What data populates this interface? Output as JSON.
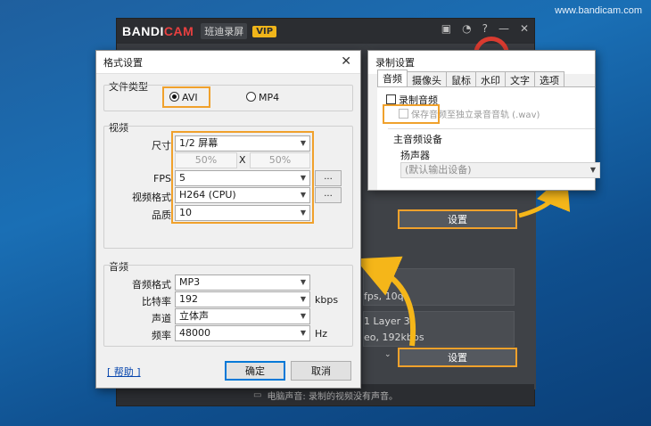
{
  "watermark": "www.bandicam.com",
  "bandicam": {
    "logo_a": "BANDI",
    "logo_b": "CAM",
    "subtitle": "班迪录屏",
    "vip": "VIP",
    "video_info": "fps, 10q",
    "audio_info_1": "1 Layer 3",
    "audio_info_2": "eo, 192kbps",
    "settings_btn_1": "设置",
    "settings_btn_2": "设置",
    "footer": "电脑声音: 录制的视频没有声音。"
  },
  "format_dialog": {
    "title": "格式设置",
    "file_type_label": "文件类型",
    "avi": "AVI",
    "mp4": "MP4",
    "video_label": "视频",
    "size_label": "尺寸",
    "size_value": "1/2 屏幕",
    "width_pct": "50%",
    "x_sep": "X",
    "height_pct": "50%",
    "fps_label": "FPS",
    "fps_value": "5",
    "more": "...",
    "vformat_label": "视频格式",
    "vformat_value": "H264 (CPU)",
    "quality_label": "品质",
    "quality_value": "10",
    "audio_label": "音频",
    "aformat_label": "音频格式",
    "aformat_value": "MP3",
    "bitrate_label": "比特率",
    "bitrate_value": "192",
    "bitrate_unit": "kbps",
    "channel_label": "声道",
    "channel_value": "立体声",
    "freq_label": "频率",
    "freq_value": "48000",
    "freq_unit": "Hz",
    "help": "[ 帮助 ]",
    "ok": "确定",
    "cancel": "取消"
  },
  "record_dialog": {
    "title": "录制设置",
    "tabs": [
      "音频",
      "摄像头",
      "鼠标",
      "水印",
      "文字",
      "选项"
    ],
    "record_audio": "录制音频",
    "save_separate": "保存音频至独立录音音轨 (.wav)",
    "main_device": "主音频设备",
    "speaker": "扬声器",
    "speaker_value": "(默认输出设备)"
  }
}
